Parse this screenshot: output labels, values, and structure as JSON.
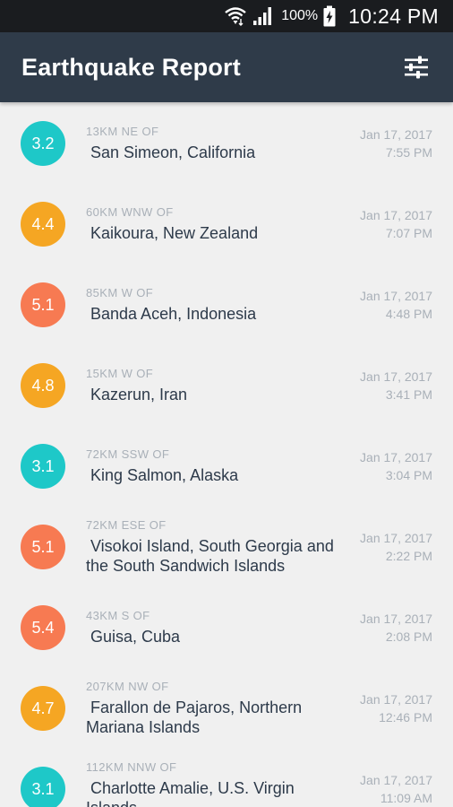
{
  "status_bar": {
    "battery_percent": "100%",
    "time": "10:24 PM",
    "icons": [
      "wifi-icon",
      "signal-icon",
      "battery-charging-icon"
    ]
  },
  "app_bar": {
    "title": "Earthquake Report",
    "filter_icon": "settings-sliders-icon"
  },
  "colors": {
    "low": "#1ec8c8",
    "moderate": "#f5a623",
    "high": "#f77a52",
    "app_bar": "#2f3b49",
    "status_bar": "#1a1c1f"
  },
  "quakes": [
    {
      "magnitude": "3.2",
      "level": "low",
      "offset": "13KM NE OF",
      "place": "San Simeon, California",
      "date": "Jan 17, 2017",
      "time": "7:55 PM"
    },
    {
      "magnitude": "4.4",
      "level": "moderate",
      "offset": "60KM WNW OF",
      "place": "Kaikoura, New Zealand",
      "date": "Jan 17, 2017",
      "time": "7:07 PM"
    },
    {
      "magnitude": "5.1",
      "level": "high",
      "offset": "85KM W OF",
      "place": "Banda Aceh, Indonesia",
      "date": "Jan 17, 2017",
      "time": "4:48 PM"
    },
    {
      "magnitude": "4.8",
      "level": "moderate",
      "offset": "15KM W OF",
      "place": "Kazerun, Iran",
      "date": "Jan 17, 2017",
      "time": "3:41 PM"
    },
    {
      "magnitude": "3.1",
      "level": "low",
      "offset": "72KM SSW OF",
      "place": "King Salmon, Alaska",
      "date": "Jan 17, 2017",
      "time": "3:04 PM"
    },
    {
      "magnitude": "5.1",
      "level": "high",
      "offset": "72KM ESE OF",
      "place": "Visokoi Island, South Georgia and the South Sandwich Islands",
      "date": "Jan 17, 2017",
      "time": "2:22 PM"
    },
    {
      "magnitude": "5.4",
      "level": "high",
      "offset": "43KM S OF",
      "place": "Guisa, Cuba",
      "date": "Jan 17, 2017",
      "time": "2:08 PM"
    },
    {
      "magnitude": "4.7",
      "level": "moderate",
      "offset": "207KM NW OF",
      "place": "Farallon de Pajaros, Northern Mariana Islands",
      "date": "Jan 17, 2017",
      "time": "12:46 PM"
    },
    {
      "magnitude": "3.1",
      "level": "low",
      "offset": "112KM NNW OF",
      "place": "Charlotte Amalie, U.S. Virgin Islands",
      "date": "Jan 17, 2017",
      "time": "11:09 AM"
    }
  ]
}
